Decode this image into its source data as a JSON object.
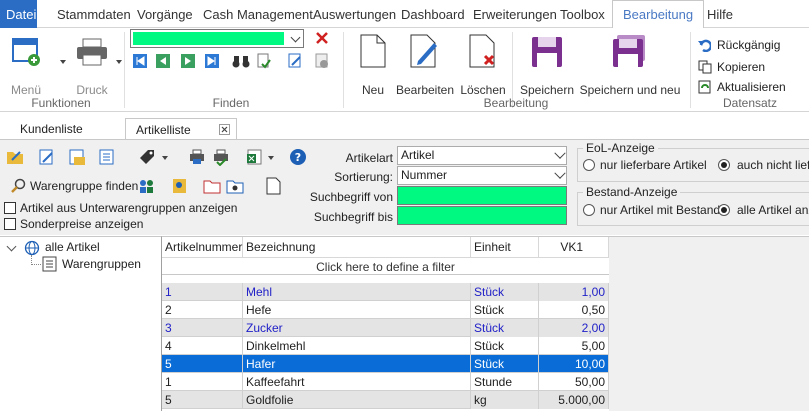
{
  "menubar": {
    "items": [
      "Datei",
      "Stammdaten",
      "Vorgänge",
      "Cash Management",
      "Auswertungen",
      "Dashboard",
      "Erweiterungen",
      "Toolbox",
      "Bearbeitung",
      "Hilfe"
    ],
    "active": "Bearbeitung"
  },
  "ribbon": {
    "funktionen": {
      "label": "Funktionen",
      "menu": "Menü",
      "druck": "Druck"
    },
    "finden": {
      "label": "Finden",
      "search_value": ""
    },
    "bearbeitung": {
      "label": "Bearbeitung",
      "neu": "Neu",
      "bearbeiten": "Bearbeiten",
      "loeschen": "Löschen",
      "speichern": "Speichern",
      "speichern_neu": "Speichern und neu"
    },
    "datensatz": {
      "label": "Datensatz",
      "rueckgaengig": "Rückgängig",
      "kopieren": "Kopieren",
      "aktualisieren": "Aktualisieren"
    }
  },
  "tabs": [
    "Kundenliste",
    "Artikelliste"
  ],
  "active_tab": "Artikelliste",
  "toolbar": {
    "warengruppe_finden": "Warengruppe finden",
    "chk_unterwarengruppen": "Artikel aus Unterwarengruppen anzeigen",
    "chk_sonderpreise": "Sonderpreise anzeigen"
  },
  "filters": {
    "artikelart_label": "Artikelart",
    "artikelart_value": "Artikel",
    "sortierung_label": "Sortierung:",
    "sortierung_value": "Nummer",
    "suchbegriff_von_label": "Suchbegriff von",
    "suchbegriff_bis_label": "Suchbegriff bis"
  },
  "eol": {
    "title": "EoL-Anzeige",
    "opt1": "nur lieferbare Artikel",
    "opt2": "auch nicht liefe",
    "selected": 2
  },
  "bestand": {
    "title": "Bestand-Anzeige",
    "opt1": "nur Artikel mit Bestand",
    "opt2": "alle Artikel anze",
    "selected": 2
  },
  "tree": {
    "root": "alle Artikel",
    "child": "Warengruppen"
  },
  "grid": {
    "headers": [
      "Artikelnummer",
      "Bezeichnung",
      "Einheit",
      "VK1"
    ],
    "filter_hint": "Click here to define a filter",
    "rows": [
      {
        "nr": "1",
        "bez": "Mehl",
        "einheit": "Stück",
        "vk": "1,00",
        "style": "blue"
      },
      {
        "nr": "2",
        "bez": "Hefe",
        "einheit": "Stück",
        "vk": "0,50",
        "style": "normal"
      },
      {
        "nr": "3",
        "bez": "Zucker",
        "einheit": "Stück",
        "vk": "2,00",
        "style": "blue"
      },
      {
        "nr": "4",
        "bez": "Dinkelmehl",
        "einheit": "Stück",
        "vk": "5,00",
        "style": "normal"
      },
      {
        "nr": "5",
        "bez": "Hafer",
        "einheit": "Stück",
        "vk": "10,00",
        "style": "selected"
      },
      {
        "nr": "1",
        "bez": "Kaffeefahrt",
        "einheit": "Stunde",
        "vk": "50,00",
        "style": "normal"
      },
      {
        "nr": "5",
        "bez": "Goldfolie",
        "einheit": "kg",
        "vk": "5.000,00",
        "style": "normal"
      }
    ]
  },
  "colors": {
    "accent": "#2b6dc4",
    "green": "#00f980",
    "selected_row": "#0a6cd6",
    "blue_text": "#2121c8",
    "purple": "#7b2f8f"
  }
}
